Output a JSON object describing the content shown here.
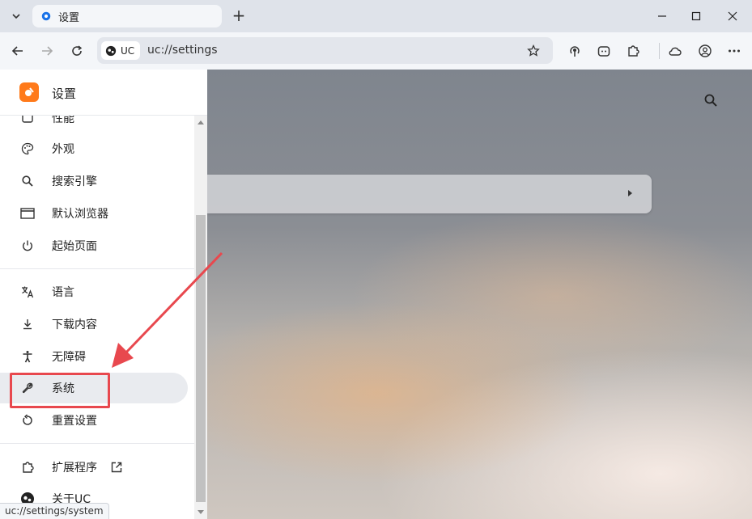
{
  "tabstrip": {
    "tab_title": "设置",
    "new_tab_label": "+"
  },
  "toolbar": {
    "uc_chip_label": "UC",
    "url": "uc://settings"
  },
  "sidebar": {
    "title": "设置",
    "items": [
      {
        "label": "性能",
        "icon": "performance-icon"
      },
      {
        "label": "外观",
        "icon": "palette-icon"
      },
      {
        "label": "搜索引擎",
        "icon": "search-icon"
      },
      {
        "label": "默认浏览器",
        "icon": "browser-window-icon"
      },
      {
        "label": "起始页面",
        "icon": "power-icon"
      },
      {
        "label": "语言",
        "icon": "translate-icon"
      },
      {
        "label": "下载内容",
        "icon": "download-icon"
      },
      {
        "label": "无障碍",
        "icon": "accessibility-icon"
      },
      {
        "label": "系统",
        "icon": "wrench-icon",
        "active": true
      },
      {
        "label": "重置设置",
        "icon": "reset-icon"
      },
      {
        "label": "扩展程序",
        "icon": "puzzle-icon"
      },
      {
        "label": "关于UC",
        "icon": "uc-logo-icon"
      }
    ]
  },
  "status_bar": {
    "url": "uc://settings/system"
  },
  "colors": {
    "accent": "#1a73e8",
    "brand": "#ff7a1a",
    "highlight": "#e8484e"
  }
}
